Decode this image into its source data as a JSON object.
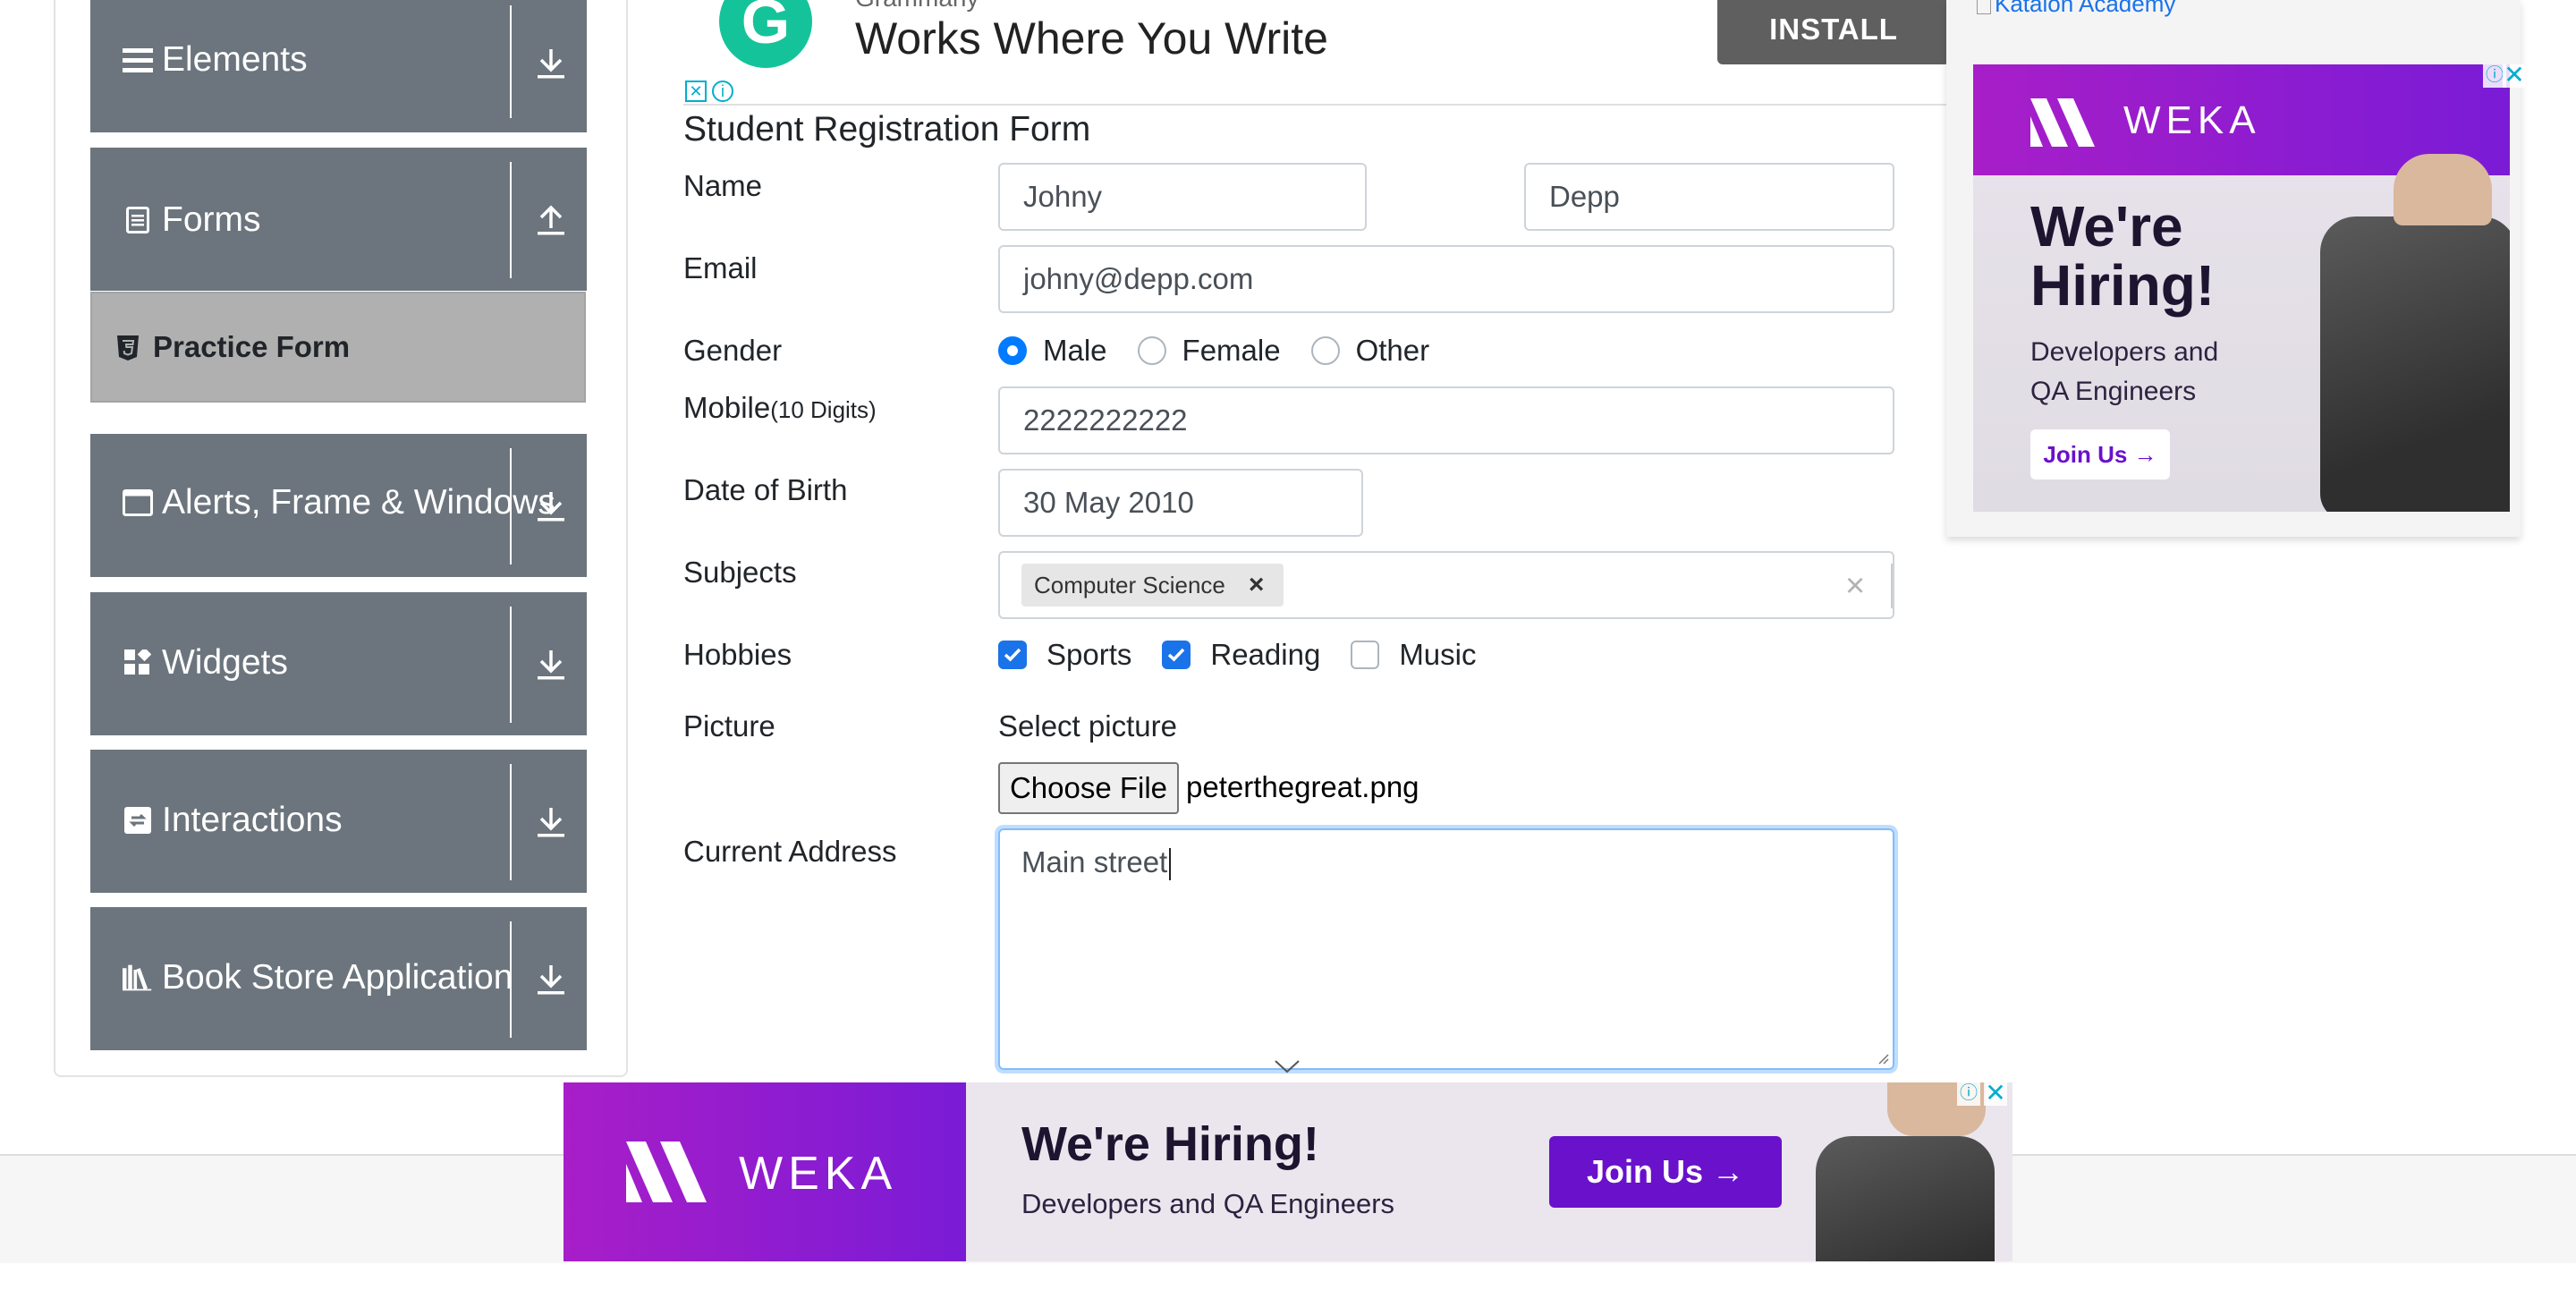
{
  "sidebar": {
    "groups": [
      {
        "label": "Elements",
        "icon": "list-icon",
        "toggle_icon": "expand-download-icon"
      },
      {
        "label": "Forms",
        "icon": "document-icon",
        "toggle_icon": "collapse-upload-icon"
      },
      {
        "label": "Alerts, Frame & Windows",
        "icon": "window-icon",
        "toggle_icon": "expand-download-icon"
      },
      {
        "label": "Widgets",
        "icon": "widgets-icon",
        "toggle_icon": "expand-download-icon"
      },
      {
        "label": "Interactions",
        "icon": "interactions-icon",
        "toggle_icon": "expand-download-icon"
      },
      {
        "label": "Book Store Application",
        "icon": "books-icon",
        "toggle_icon": "expand-download-icon"
      }
    ],
    "active_item": {
      "label": "Practice Form",
      "icon": "html5-icon"
    }
  },
  "top_ad": {
    "brand": "Grammarly",
    "headline": "Works Where You Write",
    "cta": "INSTALL",
    "logo_letter": "G"
  },
  "form": {
    "title": "Student Registration Form",
    "name_label": "Name",
    "first_name": "Johny",
    "last_name": "Depp",
    "email_label": "Email",
    "email": "johny@depp.com",
    "gender_label": "Gender",
    "gender_options": [
      "Male",
      "Female",
      "Other"
    ],
    "gender_selected": "Male",
    "mobile_label": "Mobile",
    "mobile_hint": "(10 Digits)",
    "mobile": "2222222222",
    "dob_label": "Date of Birth",
    "dob": "30 May 2010",
    "subjects_label": "Subjects",
    "subjects": [
      "Computer Science"
    ],
    "subject_remove": "×",
    "subjects_clear": "×",
    "hobbies_label": "Hobbies",
    "hobbies": [
      {
        "label": "Sports",
        "checked": true
      },
      {
        "label": "Reading",
        "checked": true
      },
      {
        "label": "Music",
        "checked": false
      }
    ],
    "picture_label": "Picture",
    "picture_select": "Select picture",
    "choose_file": "Choose File",
    "file_name": "peterthegreat.png",
    "address_label": "Current Address",
    "address": "Main street"
  },
  "right_ad": {
    "broken_image_alt": "Katalon Academy",
    "brand": "WEKA",
    "headline": "We're Hiring!",
    "sub": "Developers and QA Engineers",
    "cta": "Join Us →"
  },
  "bottom_ad": {
    "brand": "WEKA",
    "headline": "We're Hiring!",
    "sub": "Developers and QA Engineers",
    "cta": "Join Us →"
  },
  "colors": {
    "sidebar_group": "#6c757d",
    "active_item": "#b0b0b0",
    "primary": "#007bff",
    "weka_purple": "#7a1bd6"
  }
}
